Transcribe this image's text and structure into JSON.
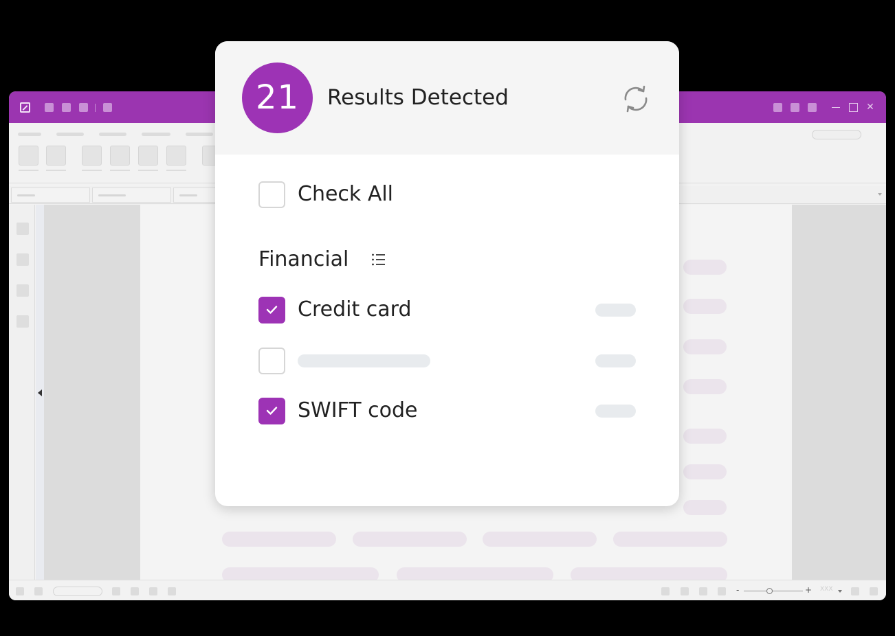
{
  "panel": {
    "result_count": "21",
    "title": "Results Detected",
    "refresh_icon": "refresh-icon",
    "check_all": {
      "label": "Check All",
      "checked": false
    }
  },
  "sections": [
    {
      "title": "Financial",
      "icon": "list-icon",
      "items": [
        {
          "label": "Credit card",
          "checked": true
        },
        {
          "label": "",
          "checked": false
        },
        {
          "label": "SWIFT code",
          "checked": true
        }
      ]
    }
  ],
  "colors": {
    "accent": "#9d33b5",
    "titlebar": "#9b35b0",
    "header_bg": "#f5f5f5",
    "checkbox_border": "#d6d6d6",
    "placeholder": "#e8ebee"
  },
  "background_app": {
    "window_controls": [
      "minimize-icon",
      "maximize-icon",
      "close-icon"
    ],
    "zoom_value": "XXX"
  }
}
